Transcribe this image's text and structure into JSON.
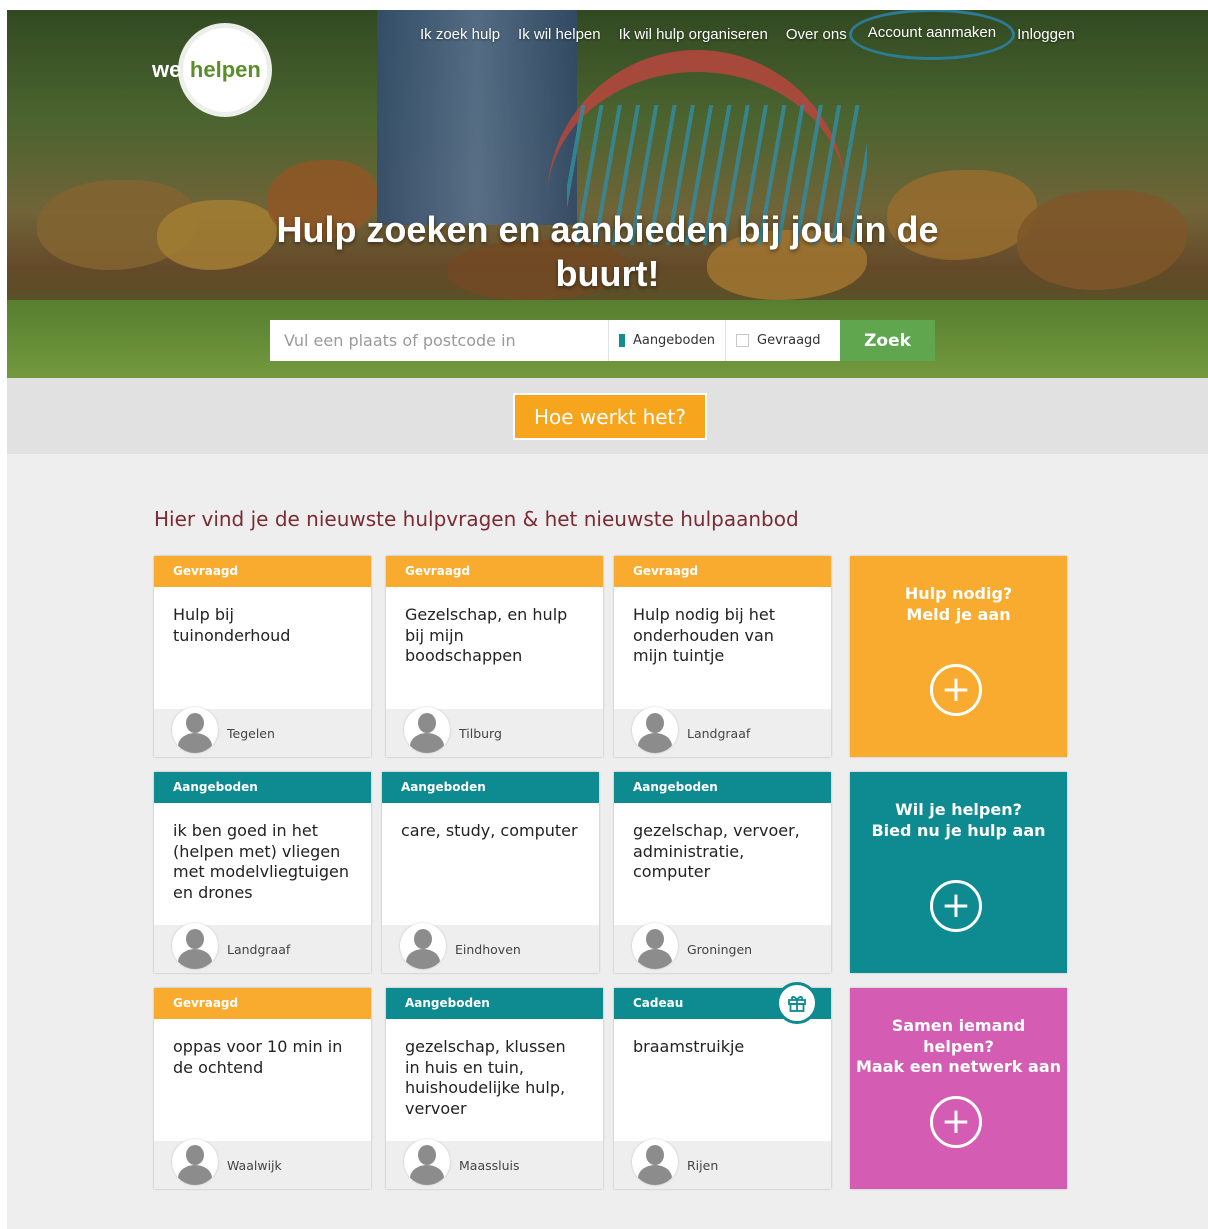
{
  "header": {
    "logo_we": "we",
    "logo_helpen": "helpen",
    "nav": [
      "Ik zoek hulp",
      "Ik wil helpen",
      "Ik wil hulp organiseren",
      "Over ons",
      "Account aanmaken",
      "Inloggen"
    ]
  },
  "hero": {
    "title_line1": "Hulp zoeken en aanbieden bij jou in de",
    "title_line2": "buurt!"
  },
  "search": {
    "placeholder": "Vul een plaats of postcode in",
    "option_offered": "Aangeboden",
    "option_requested": "Gevraagd",
    "offered_checked": true,
    "requested_checked": false,
    "submit": "Zoek"
  },
  "how_button": "Hoe werkt het?",
  "section_title": "Hier vind je de nieuwste hulpvragen & het nieuwste hulpaanbod",
  "cards": [
    {
      "type": "Gevraagd",
      "text": "Hulp bij tuinonderhoud",
      "city": "Tegelen"
    },
    {
      "type": "Gevraagd",
      "text": "Gezelschap, en hulp bij mijn boodschappen",
      "city": "Tilburg"
    },
    {
      "type": "Gevraagd",
      "text": "Hulp nodig bij het onderhouden van mijn tuintje",
      "city": "Landgraaf"
    },
    {
      "type": "Aangeboden",
      "text": "ik ben goed in het (helpen met) vliegen met modelvliegtuigen en drones",
      "city": "Landgraaf"
    },
    {
      "type": "Aangeboden",
      "text": "care, study, computer",
      "city": "Eindhoven"
    },
    {
      "type": "Aangeboden",
      "text": "gezelschap, vervoer, administratie, computer",
      "city": "Groningen"
    },
    {
      "type": "Gevraagd",
      "text": "oppas voor 10 min in de ochtend",
      "city": "Waalwijk"
    },
    {
      "type": "Aangeboden",
      "text": "gezelschap, klussen in huis en tuin, huishoudelijke hulp, vervoer",
      "city": "Maassluis"
    },
    {
      "type": "Cadeau",
      "text": "braamstruikje",
      "city": "Rijen"
    }
  ],
  "cta": [
    {
      "line1": "Hulp nodig?",
      "line2": "Meld je aan",
      "line3": "",
      "color": "#f8ab2f"
    },
    {
      "line1": "Wil je helpen?",
      "line2": "Bied nu je hulp aan",
      "line3": "",
      "color": "#0e8a91"
    },
    {
      "line1": "Samen iemand",
      "line2": "helpen?",
      "line3": "Maak een netwerk aan",
      "color": "#d45db3"
    }
  ],
  "icons": {
    "avatar": "user-silhouette-icon",
    "gift": "gift-icon",
    "plus": "plus-circle-icon"
  }
}
